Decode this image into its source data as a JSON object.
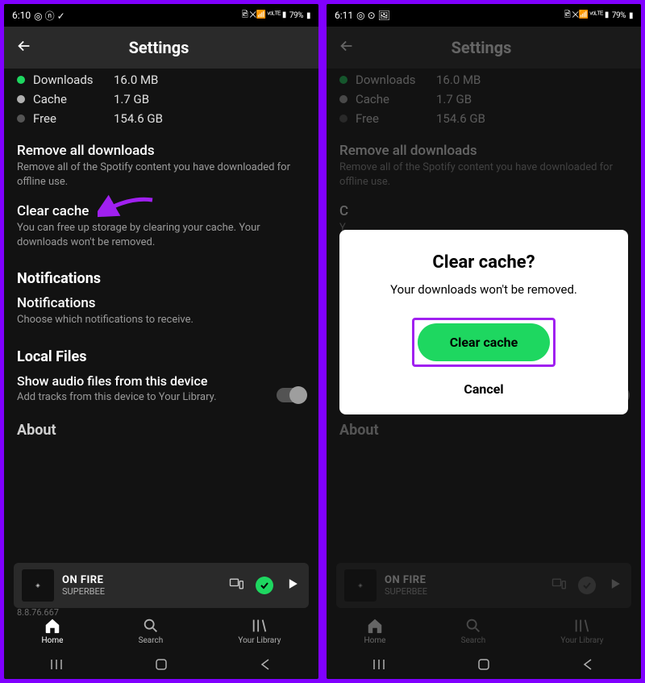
{
  "left": {
    "status": {
      "time": "6:10",
      "right": "79%"
    },
    "header": {
      "title": "Settings"
    },
    "storage": {
      "downloads": {
        "label": "Downloads",
        "value": "16.0 MB"
      },
      "cache": {
        "label": "Cache",
        "value": "1.7 GB"
      },
      "free": {
        "label": "Free",
        "value": "154.6 GB"
      }
    },
    "removeDownloads": {
      "title": "Remove all downloads",
      "sub": "Remove all of the Spotify content you have downloaded for offline use."
    },
    "clearCache": {
      "title": "Clear cache",
      "sub": "You can free up storage by clearing your cache. Your downloads won't be removed."
    },
    "notificationsHead": "Notifications",
    "notifications": {
      "title": "Notifications",
      "sub": "Choose which notifications to receive."
    },
    "localFilesHead": "Local Files",
    "localFiles": {
      "title": "Show audio files from this device",
      "sub": "Add tracks from this device to Your Library."
    },
    "aboutPeek": "About",
    "nowPlaying": {
      "title": "ON FIRE",
      "artist": "SUPERBEE"
    },
    "version": "8.8.76.667",
    "tabs": {
      "home": "Home",
      "search": "Search",
      "library": "Your Library"
    }
  },
  "right": {
    "status": {
      "time": "6:11",
      "right": "79%"
    },
    "dialog": {
      "title": "Clear cache?",
      "message": "Your downloads won't be removed.",
      "primary": "Clear cache",
      "cancel": "Cancel"
    }
  }
}
